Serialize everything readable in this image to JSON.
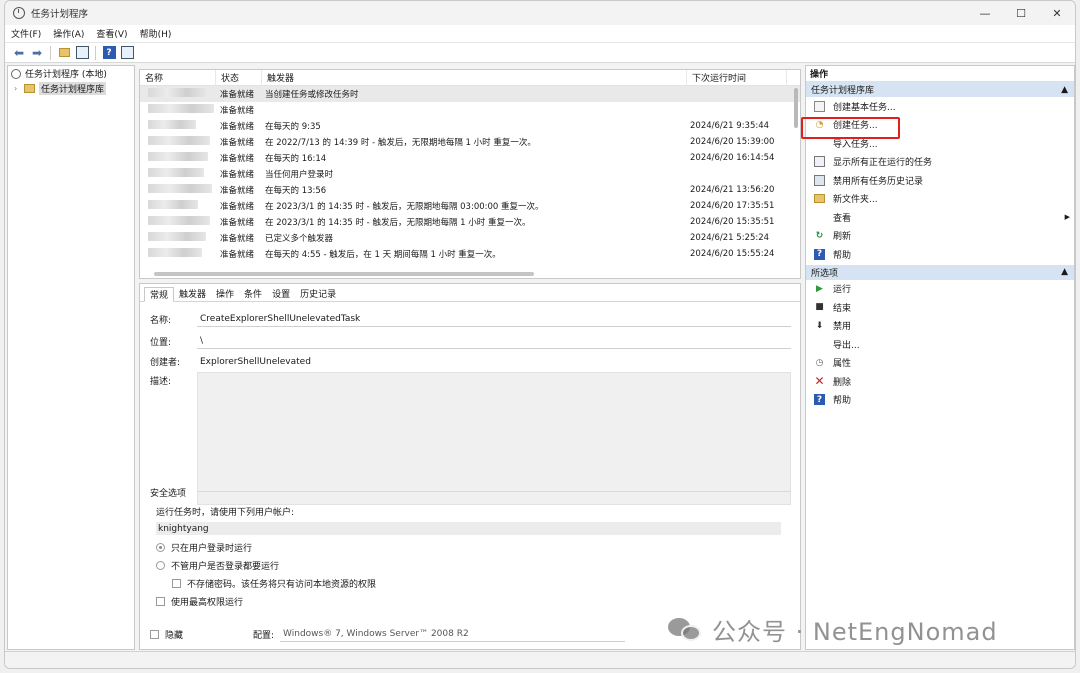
{
  "window": {
    "title": "任务计划程序",
    "minimize": "—",
    "maximize": "☐",
    "close": "✕"
  },
  "menu": [
    {
      "label": "文件(F)"
    },
    {
      "label": "操作(A)"
    },
    {
      "label": "查看(V)"
    },
    {
      "label": "帮助(H)"
    }
  ],
  "tree": {
    "root": "任务计划程序 (本地)",
    "child": "任务计划程序库"
  },
  "task_list": {
    "headers": {
      "name": "名称",
      "status": "状态",
      "trigger": "触发器",
      "next_run": "下次运行时间"
    },
    "rows": [
      {
        "status": "准备就绪",
        "trigger": "当创建任务或修改任务时",
        "next_run": ""
      },
      {
        "status": "准备就绪",
        "trigger": "",
        "next_run": ""
      },
      {
        "status": "准备就绪",
        "trigger": "在每天的 9:35",
        "next_run": "2024/6/21 9:35:44"
      },
      {
        "status": "准备就绪",
        "trigger": "在 2022/7/13 的 14:39 时 - 触发后，无限期地每隔 1 小时 重复一次。",
        "next_run": "2024/6/20 15:39:00"
      },
      {
        "status": "准备就绪",
        "trigger": "在每天的 16:14",
        "next_run": "2024/6/20 16:14:54"
      },
      {
        "status": "准备就绪",
        "trigger": "当任何用户登录时",
        "next_run": ""
      },
      {
        "status": "准备就绪",
        "trigger": "在每天的 13:56",
        "next_run": "2024/6/21 13:56:20"
      },
      {
        "status": "准备就绪",
        "trigger": "在 2023/3/1 的 14:35 时 - 触发后，无限期地每隔 03:00:00 重复一次。",
        "next_run": "2024/6/20 17:35:51"
      },
      {
        "status": "准备就绪",
        "trigger": "在 2023/3/1 的 14:35 时 - 触发后，无限期地每隔 1 小时 重复一次。",
        "next_run": "2024/6/20 15:35:51"
      },
      {
        "status": "准备就绪",
        "trigger": "已定义多个触发器",
        "next_run": "2024/6/21 5:25:24"
      },
      {
        "status": "准备就绪",
        "trigger": "在每天的 4:55 - 触发后，在 1 天 期间每隔 1 小时 重复一次。",
        "next_run": "2024/6/20 15:55:24"
      }
    ]
  },
  "tabs": [
    "常规",
    "触发器",
    "操作",
    "条件",
    "设置",
    "历史记录"
  ],
  "general": {
    "name_label": "名称:",
    "name_value": "CreateExplorerShellUnelevatedTask",
    "location_label": "位置:",
    "location_value": "\\",
    "author_label": "创建者:",
    "author_value": "ExplorerShellUnelevated",
    "desc_label": "描述:"
  },
  "security": {
    "title": "安全选项",
    "run_as_label": "运行任务时，请使用下列用户帐户:",
    "user": "knightyang",
    "opt_logged_on": "只在用户登录时运行",
    "opt_whether": "不管用户是否登录都要运行",
    "opt_no_password": "不存储密码。该任务将只有访问本地资源的权限",
    "opt_highest": "使用最高权限运行",
    "hidden_label": "隐藏",
    "config_label": "配置:",
    "config_value": "Windows® 7, Windows Server™ 2008 R2"
  },
  "actions": {
    "title": "操作",
    "library_section": "任务计划程序库",
    "library_items": [
      {
        "label": "创建基本任务...",
        "icon": "wizard-icon"
      },
      {
        "label": "创建任务...",
        "icon": "new-task-icon"
      },
      {
        "label": "导入任务...",
        "icon": ""
      },
      {
        "label": "显示所有正在运行的任务",
        "icon": "running-tasks-icon"
      },
      {
        "label": "禁用所有任务历史记录",
        "icon": "history-icon"
      },
      {
        "label": "新文件夹...",
        "icon": "folder-icon"
      },
      {
        "label": "查看",
        "icon": ""
      },
      {
        "label": "刷新",
        "icon": "refresh-icon"
      },
      {
        "label": "帮助",
        "icon": "help-icon"
      }
    ],
    "selected_section": "所选项",
    "selected_items": [
      {
        "label": "运行",
        "icon": "play-icon"
      },
      {
        "label": "结束",
        "icon": "stop-icon"
      },
      {
        "label": "禁用",
        "icon": "disable-icon"
      },
      {
        "label": "导出...",
        "icon": ""
      },
      {
        "label": "属性",
        "icon": "properties-icon"
      },
      {
        "label": "删除",
        "icon": "delete-icon"
      },
      {
        "label": "帮助",
        "icon": "help-icon"
      }
    ]
  },
  "watermark": "公众号 · NetEngNomad",
  "colors": {
    "section_bg": "#d5e3f2",
    "highlight": "#e0201a",
    "help_blue": "#2d5bb0"
  }
}
